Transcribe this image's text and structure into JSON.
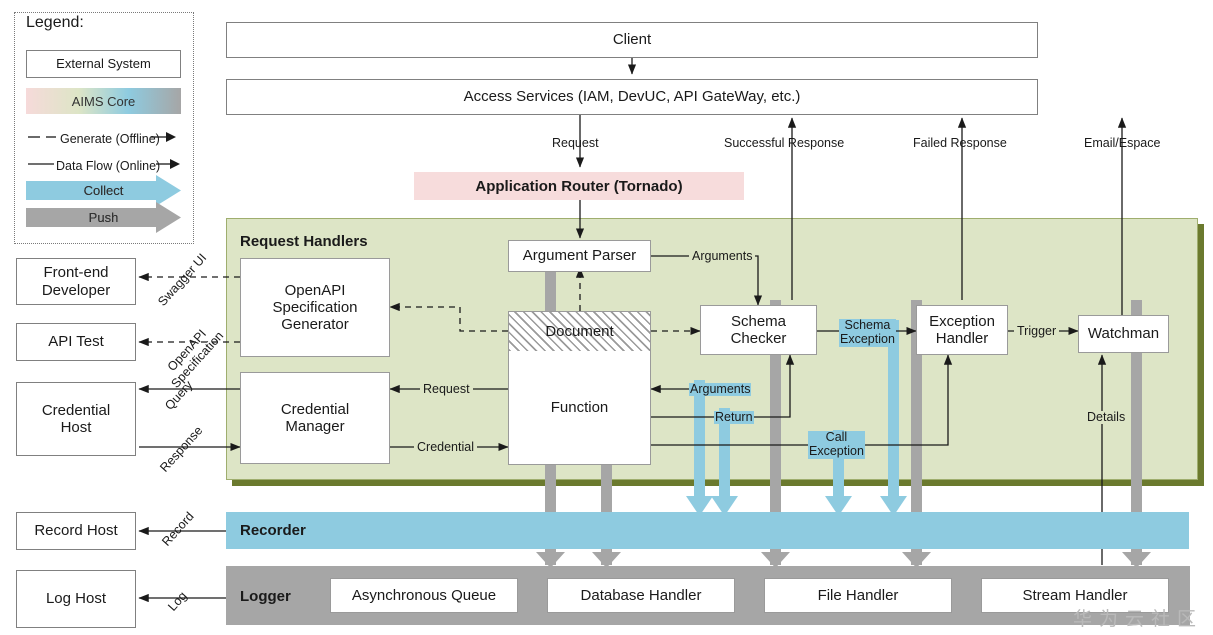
{
  "legend": {
    "title": "Legend:",
    "external_system": "External System",
    "aims_core": "AIMS Core",
    "generate": "Generate (Offline)",
    "dataflow": "Data Flow (Online)",
    "collect": "Collect",
    "push": "Push"
  },
  "top": {
    "client": "Client",
    "access_services": "Access Services (IAM, DevUC, API GateWay, etc.)",
    "router": "Application Router (Tornado)",
    "request": "Request",
    "successful_response": "Successful Response",
    "failed_response": "Failed Response",
    "email_espace": "Email/Espace"
  },
  "external": {
    "frontend_developer": "Front-end\nDeveloper",
    "api_test": "API Test",
    "credential_host": "Credential\nHost",
    "record_host": "Record Host",
    "log_host": "Log Host"
  },
  "external_labels": {
    "swagger_ui": "Swagger UI",
    "openapi_spec": "OpenAPI\nSpecification",
    "query": "Query",
    "response": "Response",
    "record": "Record",
    "log": "Log"
  },
  "core": {
    "request_handlers": "Request Handlers",
    "openapi_generator": "OpenAPI\nSpecification\nGenerator",
    "credential_manager": "Credential\nManager",
    "argument_parser": "Argument Parser",
    "document": "Document",
    "function": "Function",
    "schema_checker": "Schema\nChecker",
    "exception_handler": "Exception\nHandler",
    "watchman": "Watchman"
  },
  "core_labels": {
    "arguments_top": "Arguments",
    "arguments_mid": "Arguments",
    "return": "Return",
    "request": "Request",
    "credential": "Credential",
    "schema_exception": "Schema\nException",
    "call_exception": "Call\nException",
    "trigger": "Trigger",
    "details": "Details"
  },
  "bottom": {
    "recorder": "Recorder",
    "logger": "Logger",
    "handlers": [
      "Asynchronous Queue",
      "Database Handler",
      "File Handler",
      "Stream Handler"
    ]
  },
  "watermark": "华为云社区",
  "colors": {
    "core_green": "#dde5c6",
    "core_green_border": "#9fae6e",
    "router_pink": "#f7dcdc",
    "collect_blue": "#8ecbe0",
    "push_gray": "#a6a6a6",
    "box_border": "#808080"
  }
}
